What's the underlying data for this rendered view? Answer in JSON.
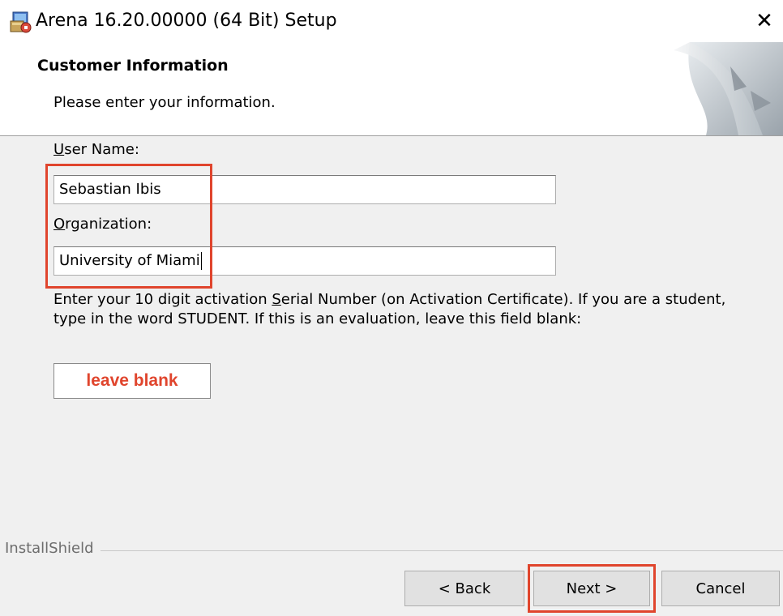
{
  "window": {
    "title": "Arena 16.20.00000  (64 Bit) Setup",
    "close_glyph": "✕"
  },
  "header": {
    "title": "Customer Information",
    "subtitle": "Please enter your information."
  },
  "form": {
    "user_name_label_mnemonic": "U",
    "user_name_label_rest": "ser Name:",
    "user_name_value": "Sebastian Ibis",
    "organization_label_mnemonic": "O",
    "organization_label_rest": "rganization:",
    "organization_value": "University of Miami",
    "serial_text_before": "Enter your 10 digit activation ",
    "serial_text_mnemonic": "S",
    "serial_text_after": "erial Number (on Activation Certificate).  If you are a student, type in the word STUDENT.  If this is an evaluation, leave this field blank:",
    "serial_annotation": "leave blank"
  },
  "footer": {
    "brand": "InstallShield"
  },
  "buttons": {
    "back": "< Back",
    "next": "Next >",
    "cancel": "Cancel"
  },
  "colors": {
    "annotation_red": "#e0452d",
    "dialog_bg": "#f0f0f0",
    "button_bg": "#e1e1e1"
  },
  "icons": [
    "installer-icon",
    "close-icon",
    "installshield-graphic"
  ]
}
